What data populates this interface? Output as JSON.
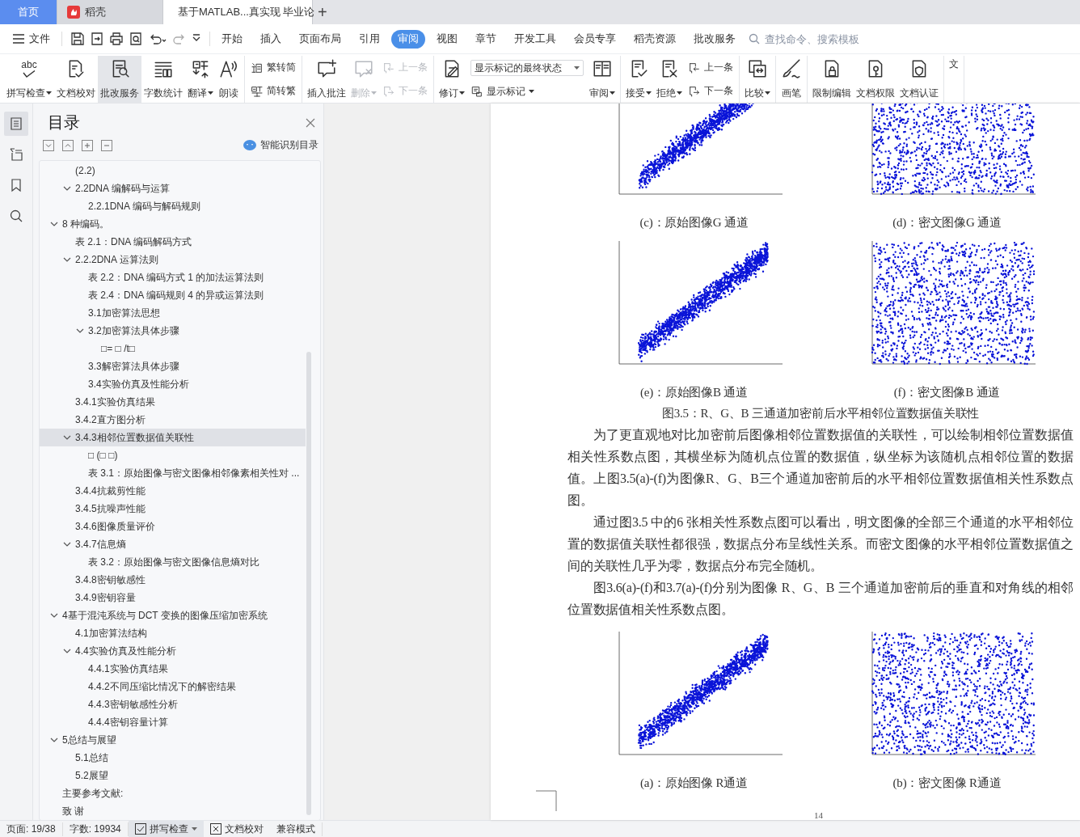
{
  "tabs": [
    {
      "label": "首页",
      "kind": "home",
      "selected": false
    },
    {
      "label": "稻壳",
      "kind": "app",
      "selected": false
    },
    {
      "label": "基于MATLAB...真实现 毕业论",
      "kind": "doc",
      "selected": true
    }
  ],
  "new_tab": "+",
  "menu": {
    "file": "文件",
    "tabs": [
      {
        "label": "开始",
        "selected": false
      },
      {
        "label": "插入",
        "selected": false
      },
      {
        "label": "页面布局",
        "selected": false
      },
      {
        "label": "引用",
        "selected": false
      },
      {
        "label": "审阅",
        "selected": true
      },
      {
        "label": "视图",
        "selected": false
      },
      {
        "label": "章节",
        "selected": false
      },
      {
        "label": "开发工具",
        "selected": false
      },
      {
        "label": "会员专享",
        "selected": false
      },
      {
        "label": "稻壳资源",
        "selected": false
      },
      {
        "label": "批改服务",
        "selected": false
      }
    ],
    "search_placeholder": "查找命令、搜索模板"
  },
  "ribbon": [
    {
      "items": [
        {
          "kind": "spell",
          "glyph": "abc",
          "label": "拼写检查",
          "dropdown": true,
          "disabled": false,
          "active": false
        },
        {
          "kind": "doc-check",
          "label": "文档校对",
          "dropdown": false,
          "disabled": false,
          "active": false
        },
        {
          "kind": "doc-search",
          "label": "批改服务",
          "dropdown": false,
          "disabled": false,
          "active": true
        },
        {
          "kind": "lines",
          "label": "字数统计",
          "dropdown": false,
          "disabled": false,
          "active": false
        },
        {
          "kind": "translate",
          "label": "翻译",
          "dropdown": true,
          "disabled": false,
          "active": false
        },
        {
          "kind": "speaker",
          "label": "朗读",
          "dropdown": false,
          "disabled": false,
          "active": false
        }
      ]
    },
    {
      "items": [
        {
          "kind": "stack",
          "items": [
            {
              "kind": "trad",
              "label": "繁转简",
              "dropdown": false,
              "disabled": false
            },
            {
              "kind": "simp",
              "label": "简转繁",
              "dropdown": false,
              "disabled": false
            }
          ]
        }
      ]
    },
    {
      "items": [
        {
          "kind": "comment",
          "label": "插入批注",
          "dropdown": false,
          "disabled": false,
          "active": false
        },
        {
          "kind": "comment-x",
          "label": "删除",
          "dropdown": true,
          "disabled": true,
          "active": false
        },
        {
          "kind": "stack",
          "items": [
            {
              "kind": "prev",
              "label": "上一条",
              "dropdown": false,
              "disabled": true
            },
            {
              "kind": "next",
              "label": "下一条",
              "dropdown": false,
              "disabled": true
            }
          ]
        }
      ]
    },
    {
      "items": [
        {
          "kind": "doc-pen",
          "label": "修订",
          "dropdown": true,
          "disabled": false,
          "active": false
        },
        {
          "kind": "stack",
          "items": [
            {
              "kind": "select",
              "value": "显示标记的最终状态"
            },
            {
              "kind": "markup",
              "label": "显示标记",
              "dropdown": true,
              "disabled": false
            }
          ]
        },
        {
          "kind": "panel",
          "label": "审阅",
          "dropdown": true,
          "disabled": false,
          "active": false
        }
      ]
    },
    {
      "items": [
        {
          "kind": "accept",
          "label": "接受",
          "dropdown": true,
          "disabled": false,
          "active": false
        },
        {
          "kind": "reject",
          "label": "拒绝",
          "dropdown": true,
          "disabled": false,
          "active": false
        },
        {
          "kind": "stack",
          "items": [
            {
              "kind": "prev",
              "label": "上一条",
              "dropdown": false,
              "disabled": false
            },
            {
              "kind": "next",
              "label": "下一条",
              "dropdown": false,
              "disabled": false
            }
          ]
        }
      ]
    },
    {
      "items": [
        {
          "kind": "compare",
          "label": "比较",
          "dropdown": true,
          "disabled": false,
          "active": false
        }
      ]
    },
    {
      "items": [
        {
          "kind": "brush",
          "label": "画笔",
          "dropdown": false,
          "disabled": false,
          "active": false
        }
      ]
    },
    {
      "items": [
        {
          "kind": "lock",
          "label": "限制编辑",
          "dropdown": false,
          "disabled": false,
          "active": false
        },
        {
          "kind": "key",
          "label": "文档权限",
          "dropdown": false,
          "disabled": false,
          "active": false
        },
        {
          "kind": "shield",
          "label": "文档认证",
          "dropdown": false,
          "disabled": false,
          "active": false
        }
      ]
    },
    {
      "items": [
        {
          "kind": "plain",
          "label": "文",
          "dropdown": false,
          "disabled": false,
          "active": false
        }
      ]
    }
  ],
  "rail": [
    {
      "kind": "outline",
      "selected": true
    },
    {
      "kind": "navigation",
      "selected": false
    },
    {
      "kind": "bookmark",
      "selected": false
    },
    {
      "kind": "search",
      "selected": false
    }
  ],
  "toc": {
    "title": "目录",
    "smart_button": "智能识别目录",
    "items": [
      {
        "children": [
          {
            "label": "(2.2)",
            "selected": false
          },
          {
            "label": "2.2DNA 编解码与运算",
            "selected": false,
            "expanded": true,
            "children": [
              {
                "label": "2.2.1DNA 编码与解码规则",
                "selected": false
              }
            ]
          }
        ]
      },
      {
        "label": "8 种编码。",
        "selected": false,
        "expanded": true,
        "children": [
          {
            "label": "表 2.1：DNA 编码解码方式",
            "selected": false
          },
          {
            "label": "2.2.2DNA 运算法则",
            "selected": false,
            "expanded": true,
            "children": [
              {
                "label": "表 2.2：DNA 编码方式 1 的加法运算法则",
                "selected": false
              },
              {
                "label": "表 2.4：DNA 编码规则 4 的异或运算法则",
                "selected": false
              },
              {
                "label": "3.1加密算法思想",
                "selected": false
              },
              {
                "label": "3.2加密算法具体步骤",
                "selected": false,
                "expanded": true,
                "children": [
                  {
                    "label": "□= □  /t□",
                    "selected": false
                  }
                ]
              },
              {
                "label": "3.3解密算法具体步骤",
                "selected": false
              },
              {
                "label": "3.4实验仿真及性能分析",
                "selected": false
              }
            ]
          },
          {
            "label": "3.4.1实验仿真结果",
            "selected": false
          },
          {
            "label": "3.4.2直方图分析",
            "selected": false
          },
          {
            "label": "3.4.3相邻位置数据值关联性",
            "selected": true,
            "expanded": true,
            "children": [
              {
                "label": "□ (□ □)",
                "selected": false
              },
              {
                "label": "表 3.1：原始图像与密文图像相邻像素相关性对 ...",
                "selected": false
              }
            ]
          },
          {
            "label": "3.4.4抗裁剪性能",
            "selected": false
          },
          {
            "label": "3.4.5抗噪声性能",
            "selected": false
          },
          {
            "label": "3.4.6图像质量评价",
            "selected": false
          },
          {
            "label": "3.4.7信息熵",
            "selected": false,
            "expanded": true,
            "children": [
              {
                "label": "表 3.2：原始图像与密文图像信息熵对比",
                "selected": false
              }
            ]
          },
          {
            "label": "3.4.8密钥敏感性",
            "selected": false
          },
          {
            "label": "3.4.9密钥容量",
            "selected": false
          }
        ]
      },
      {
        "label": "4基于混沌系统与 DCT 变换的图像压缩加密系统",
        "selected": false,
        "expanded": true,
        "children": [
          {
            "label": "4.1加密算法结构",
            "selected": false
          },
          {
            "label": "4.4实验仿真及性能分析",
            "selected": false,
            "expanded": true,
            "children": [
              {
                "label": "4.4.1实验仿真结果",
                "selected": false
              },
              {
                "label": "4.4.2不同压缩比情况下的解密结果",
                "selected": false
              },
              {
                "label": "4.4.3密钥敏感性分析",
                "selected": false
              },
              {
                "label": "4.4.4密钥容量计算",
                "selected": false
              }
            ]
          }
        ]
      },
      {
        "label": "5总结与展望",
        "selected": false,
        "expanded": true,
        "children": [
          {
            "label": "5.1总结",
            "selected": false
          },
          {
            "label": "5.2展望",
            "selected": false
          }
        ]
      },
      {
        "label": "主要参考文献:",
        "selected": false
      },
      {
        "label": "致 谢",
        "selected": false
      }
    ]
  },
  "document": {
    "blocks": [
      {
        "kind": "figure-row",
        "items": [
          {
            "kind": "correlated",
            "caption": "(c)：原始图像G 通道"
          },
          {
            "kind": "random",
            "caption": "(d)：密文图像G 通道"
          }
        ]
      },
      {
        "kind": "figure-row",
        "items": [
          {
            "kind": "correlated",
            "caption": "(e)：原始图像B 通道"
          },
          {
            "kind": "random",
            "caption": "(f)：密文图像B 通道"
          }
        ]
      },
      {
        "kind": "caption",
        "text": "图3.5：R、G、B 三通道加密前后水平相邻位置数据值关联性"
      },
      {
        "kind": "paragraph",
        "text": "为了更直观地对比加密前后图像相邻位置数据值的关联性，可以绘制相邻位置数据值相关性系数点图，其横坐标为随机点位置的数据值，纵坐标为该随机点相邻位置的数据值。上图3.5(a)-(f)为图像R、G、B三个通道加密前后的水平相邻位置数据值相关性系数点图。"
      },
      {
        "kind": "paragraph",
        "text": "通过图3.5 中的6 张相关性系数点图可以看出，明文图像的全部三个通道的水平相邻位置的数据值关联性都很强，数据点分布呈线性关系。而密文图像的水平相邻位置数据值之间的关联性几乎为零，数据点分布完全随机。"
      },
      {
        "kind": "paragraph",
        "text": "图3.6(a)-(f)和3.7(a)-(f)分别为图像 R、G、B 三个通道加密前后的垂直和对角线的相邻位置数据值相关性系数点图。"
      },
      {
        "kind": "figure-row",
        "items": [
          {
            "kind": "correlated",
            "caption": "(a)：原始图像  R通道"
          },
          {
            "kind": "random",
            "caption": "(b)：密文图像  R通道"
          }
        ]
      }
    ],
    "page_number": "14"
  },
  "status_bar": [
    {
      "kind": "text",
      "label": "页面: 19/38"
    },
    {
      "kind": "text",
      "label": "字数: 19934"
    },
    {
      "kind": "check-toggle",
      "label": "拼写检查",
      "dropdown": true,
      "active": true
    },
    {
      "kind": "cross-toggle",
      "label": "文档校对",
      "dropdown": false,
      "active": false
    },
    {
      "kind": "text",
      "label": "兼容模式"
    }
  ]
}
